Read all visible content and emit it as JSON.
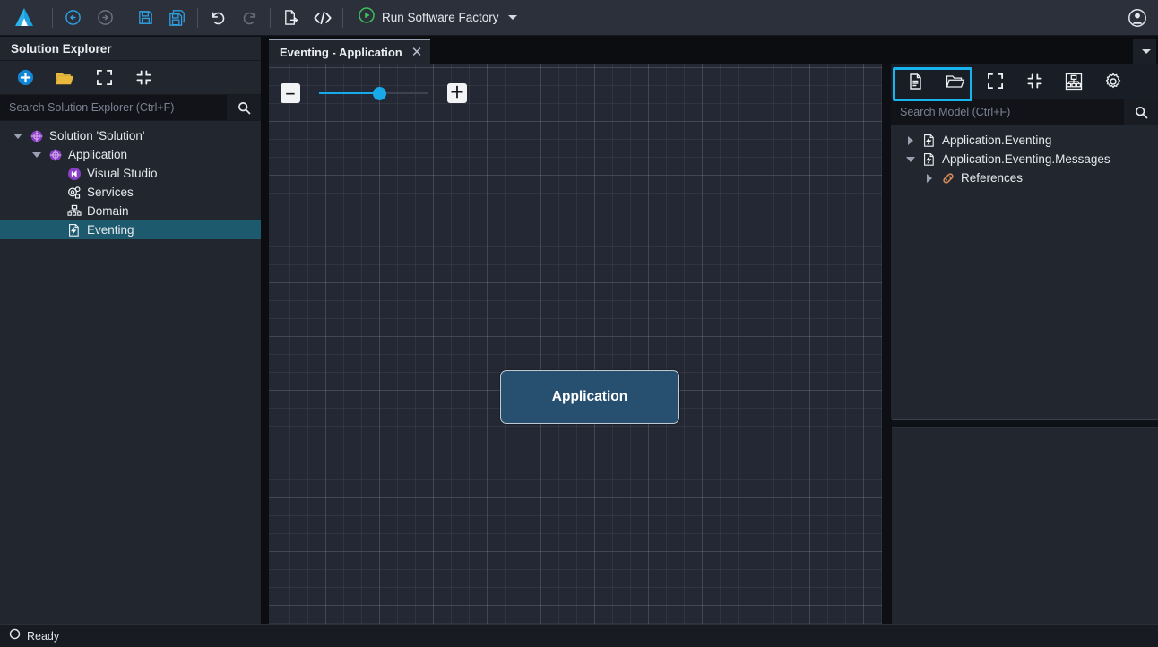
{
  "toolbar": {
    "logo_icon": "intent-architect-logo",
    "buttons": [
      {
        "name": "back-button",
        "icon": "arrow-left-circle-icon",
        "title": "Back",
        "enabled": true
      },
      {
        "name": "forward-button",
        "icon": "arrow-right-circle-icon",
        "title": "Forward",
        "enabled": false
      },
      {
        "name": "save-button",
        "icon": "save-icon",
        "title": "Save",
        "enabled": true
      },
      {
        "name": "save-all-button",
        "icon": "save-all-icon",
        "title": "Save All",
        "enabled": true
      },
      {
        "name": "undo-button",
        "icon": "undo-icon",
        "title": "Undo",
        "enabled": true
      },
      {
        "name": "redo-button",
        "icon": "redo-icon",
        "title": "Redo",
        "enabled": false
      },
      {
        "name": "export-button",
        "icon": "file-export-icon",
        "title": "Export",
        "enabled": true
      },
      {
        "name": "code-button",
        "icon": "code-brackets-icon",
        "title": "Code",
        "enabled": true
      }
    ],
    "run": {
      "label": "Run Software Factory",
      "icon": "play-circle-icon",
      "caret": "chevron-down-icon"
    },
    "user": {
      "icon": "user-account-icon"
    }
  },
  "solution_explorer": {
    "title": "Solution Explorer",
    "tools": [
      {
        "name": "add-new-button",
        "icon": "plus-circle-icon"
      },
      {
        "name": "open-folder-button",
        "icon": "open-folder-icon"
      },
      {
        "name": "expand-all-button",
        "icon": "expand-icon"
      },
      {
        "name": "collapse-all-button",
        "icon": "collapse-icon"
      }
    ],
    "search": {
      "placeholder": "Search Solution Explorer (Ctrl+F)",
      "value": "",
      "icon": "search-icon"
    },
    "tree": [
      {
        "label": "Solution 'Solution'",
        "icon": "solution-icon",
        "depth": 0,
        "twisty": "down",
        "selected": false
      },
      {
        "label": "Application",
        "icon": "application-icon",
        "depth": 1,
        "twisty": "down",
        "selected": false
      },
      {
        "label": "Visual Studio",
        "icon": "visual-studio-icon",
        "depth": 2,
        "twisty": "none",
        "selected": false
      },
      {
        "label": "Services",
        "icon": "services-icon",
        "depth": 2,
        "twisty": "none",
        "selected": false
      },
      {
        "label": "Domain",
        "icon": "domain-icon",
        "depth": 2,
        "twisty": "none",
        "selected": false
      },
      {
        "label": "Eventing",
        "icon": "eventing-icon",
        "depth": 2,
        "twisty": "none",
        "selected": true
      }
    ]
  },
  "editor": {
    "tab": {
      "label": "Eventing - Application",
      "close": "✕"
    },
    "tab_menu_icon": "chevron-down-icon",
    "zoom": {
      "minus_label": "‒",
      "plus_label": "＋",
      "percent": 55
    },
    "nodes": [
      {
        "label": "Application",
        "name": "diagram-node-application"
      }
    ]
  },
  "model_panel": {
    "tools": [
      {
        "name": "new-file-button",
        "icon": "new-file-icon",
        "highlighted": true
      },
      {
        "name": "open-folder-button",
        "icon": "open-folder-icon",
        "highlighted": true
      },
      {
        "name": "expand-all-button",
        "icon": "expand-icon",
        "highlighted": false
      },
      {
        "name": "collapse-all-button",
        "icon": "collapse-icon",
        "highlighted": false
      },
      {
        "name": "diagram-view-button",
        "icon": "diagram-icon",
        "highlighted": false
      },
      {
        "name": "settings-button",
        "icon": "gear-icon",
        "highlighted": false
      }
    ],
    "highlight_color": "#17b4f0",
    "search": {
      "placeholder": "Search Model (Ctrl+F)",
      "value": "",
      "icon": "search-icon"
    },
    "tree": [
      {
        "label": "Application.Eventing",
        "icon": "eventing-icon",
        "depth": 0,
        "twisty": "right"
      },
      {
        "label": "Application.Eventing.Messages",
        "icon": "eventing-icon",
        "depth": 0,
        "twisty": "down"
      },
      {
        "label": "References",
        "icon": "link-icon",
        "depth": 1,
        "twisty": "right"
      }
    ]
  },
  "statusbar": {
    "icon": "circle-icon",
    "text": "Ready"
  }
}
